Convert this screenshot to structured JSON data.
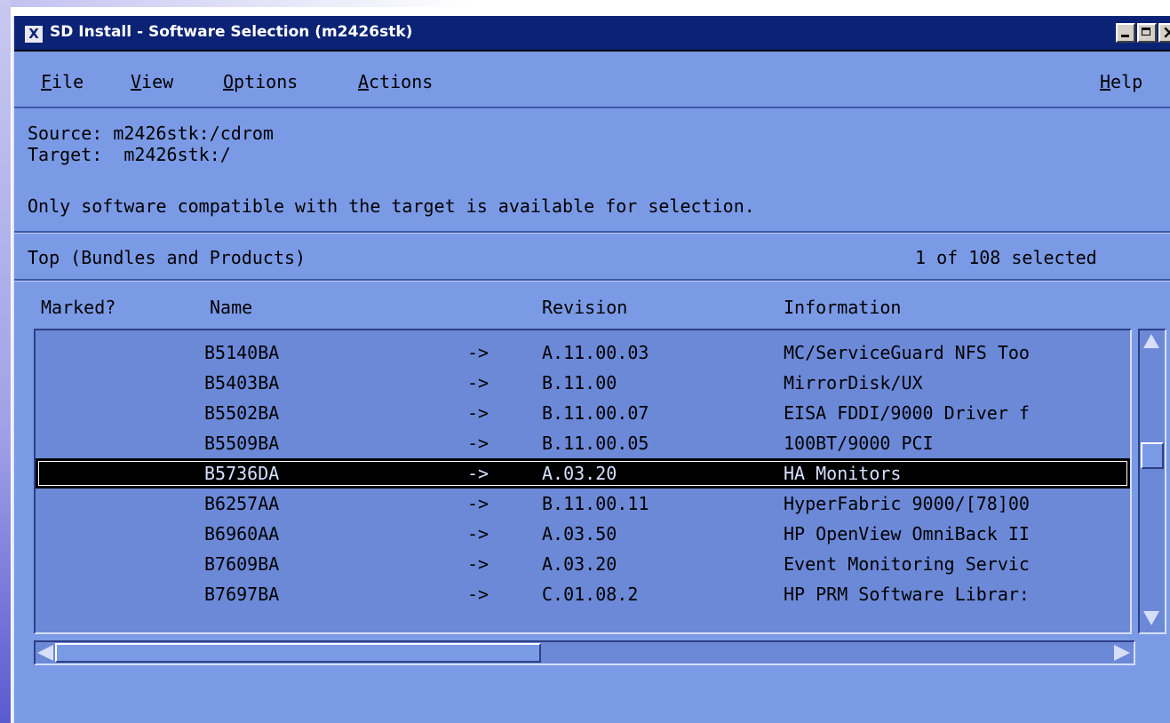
{
  "window": {
    "title_icon": "X",
    "title": "SD Install - Software Selection (m2426stk)"
  },
  "menubar": {
    "items": [
      {
        "key": "F",
        "rest": "ile"
      },
      {
        "key": "V",
        "rest": "iew"
      },
      {
        "key": "O",
        "rest": "ptions"
      },
      {
        "key": "A",
        "rest": "ctions"
      }
    ],
    "help": {
      "key": "H",
      "rest": "elp"
    }
  },
  "info": {
    "source": "Source: m2426stk:/cdrom",
    "target": "Target:  m2426stk:/",
    "note": "Only software compatible with the target is available for selection."
  },
  "list": {
    "level": "Top (Bundles and Products)",
    "selection_count": "1 of 108 selected",
    "columns": [
      "Marked?",
      "Name",
      "Revision",
      "Information"
    ],
    "rows": [
      {
        "marked": "",
        "name": "B5140BA",
        "arrow": "->",
        "revision": "A.11.00.03",
        "information": "MC/ServiceGuard NFS Too",
        "selected": false
      },
      {
        "marked": "",
        "name": "B5403BA",
        "arrow": "->",
        "revision": "B.11.00",
        "information": "MirrorDisk/UX",
        "selected": false
      },
      {
        "marked": "",
        "name": "B5502BA",
        "arrow": "->",
        "revision": "B.11.00.07",
        "information": "EISA FDDI/9000 Driver f",
        "selected": false
      },
      {
        "marked": "",
        "name": "B5509BA",
        "arrow": "->",
        "revision": "B.11.00.05",
        "information": "100BT/9000 PCI",
        "selected": false
      },
      {
        "marked": "",
        "name": "B5736DA",
        "arrow": "->",
        "revision": "A.03.20",
        "information": "HA Monitors",
        "selected": true
      },
      {
        "marked": "",
        "name": "B6257AA",
        "arrow": "->",
        "revision": "B.11.00.11",
        "information": "HyperFabric 9000/[78]00",
        "selected": false
      },
      {
        "marked": "",
        "name": "B6960AA",
        "arrow": "->",
        "revision": "A.03.50",
        "information": "HP OpenView OmniBack II",
        "selected": false
      },
      {
        "marked": "",
        "name": "B7609BA",
        "arrow": "->",
        "revision": "A.03.20",
        "information": "Event Monitoring Servic",
        "selected": false
      },
      {
        "marked": "",
        "name": "B7697BA",
        "arrow": "->",
        "revision": "C.01.08.2",
        "information": "HP PRM Software Librar:",
        "selected": false
      }
    ],
    "vertical_scroll_fraction": 0.4,
    "horizontal_scroll_visible_fraction": 0.46
  },
  "icons": {
    "window_menu": "x-window-icon",
    "minimize": "minimize-icon",
    "maximize": "maximize-icon",
    "close": "close-icon",
    "scroll_up": "scroll-up-arrow-icon",
    "scroll_down": "scroll-down-arrow-icon",
    "scroll_left": "scroll-left-arrow-icon",
    "scroll_right": "scroll-right-arrow-icon"
  }
}
